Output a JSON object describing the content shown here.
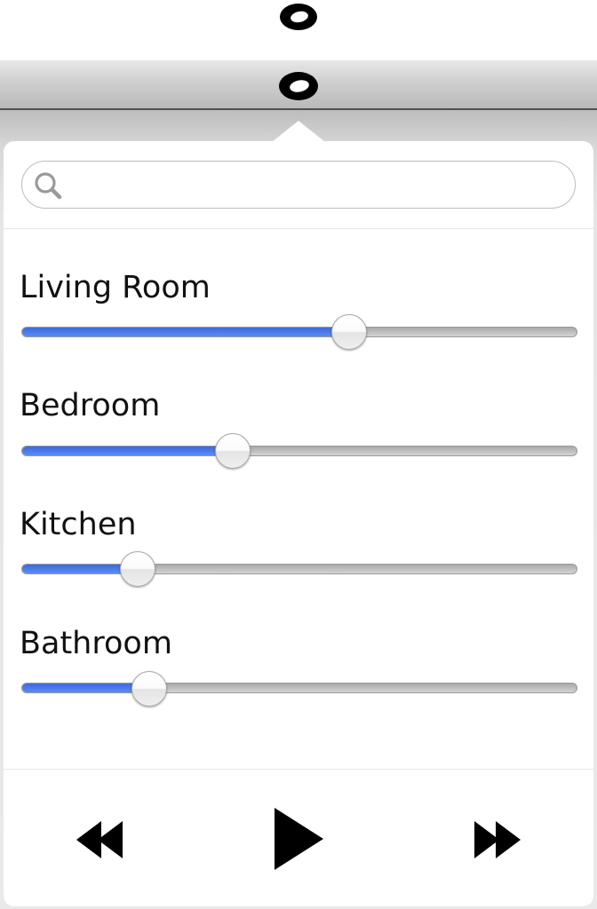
{
  "search": {
    "value": "",
    "placeholder": ""
  },
  "rooms": [
    {
      "label": "Living Room",
      "level": 0.59
    },
    {
      "label": "Bedroom",
      "level": 0.38
    },
    {
      "label": "Kitchen",
      "level": 0.21
    },
    {
      "label": "Bathroom",
      "level": 0.23
    }
  ],
  "transport": {
    "previous_icon": "rewind-icon",
    "play_icon": "play-icon",
    "next_icon": "fast-forward-icon"
  },
  "colors": {
    "slider_fill": "#3c69e0",
    "menubar": "#cfcfcf"
  }
}
